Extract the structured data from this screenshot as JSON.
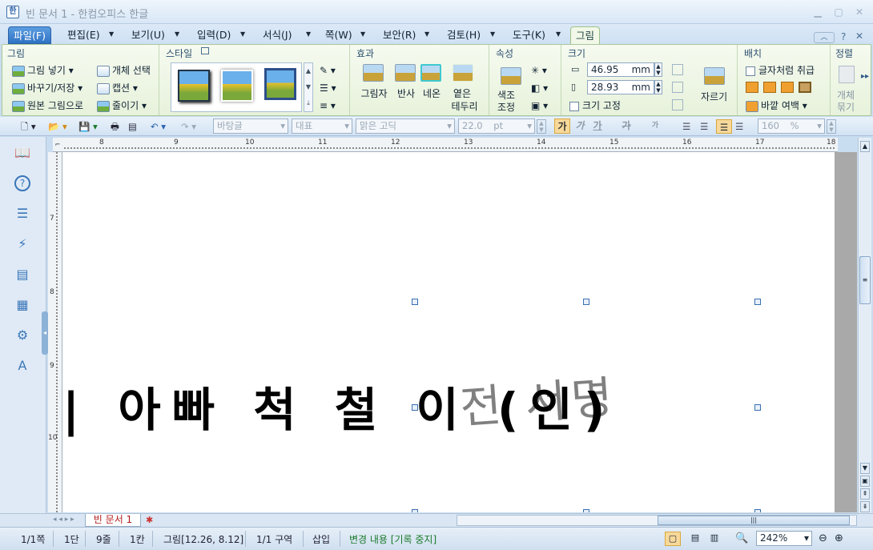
{
  "window": {
    "title": "빈 문서 1 - 한컴오피스 한글"
  },
  "menubar": {
    "items": [
      "파일(F)",
      "편집(E)",
      "보기(U)",
      "입력(D)",
      "서식(J)",
      "쪽(W)",
      "보안(R)",
      "검토(H)",
      "도구(K)",
      "그림"
    ],
    "help": "?"
  },
  "ribbon": {
    "groups": {
      "picture": "그림",
      "style": "스타일",
      "effect": "효과",
      "property": "속성",
      "size": "크기",
      "arrange": "배치",
      "align": "정렬"
    },
    "picture": {
      "insert": "그림 넣기",
      "select_obj": "개체 선택",
      "change_save": "바꾸기/저장",
      "caption": "캡션",
      "original": "원본 그림으로",
      "reduce": "줄이기"
    },
    "effect": {
      "shadow": "그림자",
      "reflect": "반사",
      "neon": "네온",
      "soft_edge_1": "옅은",
      "soft_edge_2": "테두리"
    },
    "property": {
      "color_1": "색조",
      "color_2": "조정"
    },
    "size": {
      "width": "46.95",
      "height": "28.93",
      "unit": "mm",
      "fix": "크기 고정",
      "crop": "자르기"
    },
    "arrange": {
      "treat_as_char": "글자처럼 취급",
      "outer_margin": "바깥 여백"
    },
    "align": {
      "group_1": "개체",
      "group_2": "묶기"
    }
  },
  "toolbar": {
    "para_style": "바탕글",
    "lang": "대표",
    "font": "맑은 고딕",
    "size": "22.0",
    "size_unit": "pt",
    "bold": "가",
    "italic": "가",
    "underline": "가",
    "strike": "가",
    "super": "가",
    "line_spacing": "160",
    "line_unit": "%"
  },
  "ruler": {
    "h": [
      "8",
      "9",
      "10",
      "11",
      "12",
      "13",
      "14",
      "15",
      "16",
      "17",
      "18"
    ],
    "v": [
      "7",
      "8",
      "9",
      "10"
    ]
  },
  "document": {
    "line": "| 아빠 척 철 이 (인)",
    "signature": "전 서명"
  },
  "tabs": {
    "doc_tab": "빈 문서 1"
  },
  "status": {
    "page": "1/1쪽",
    "col": "1단",
    "line": "9줄",
    "char": "1칸",
    "object": "그림[12.26, 8.12]",
    "section": "1/1 구역",
    "mode": "삽입",
    "track": "변경 내용 [기록 중지]",
    "zoom": "242%"
  }
}
